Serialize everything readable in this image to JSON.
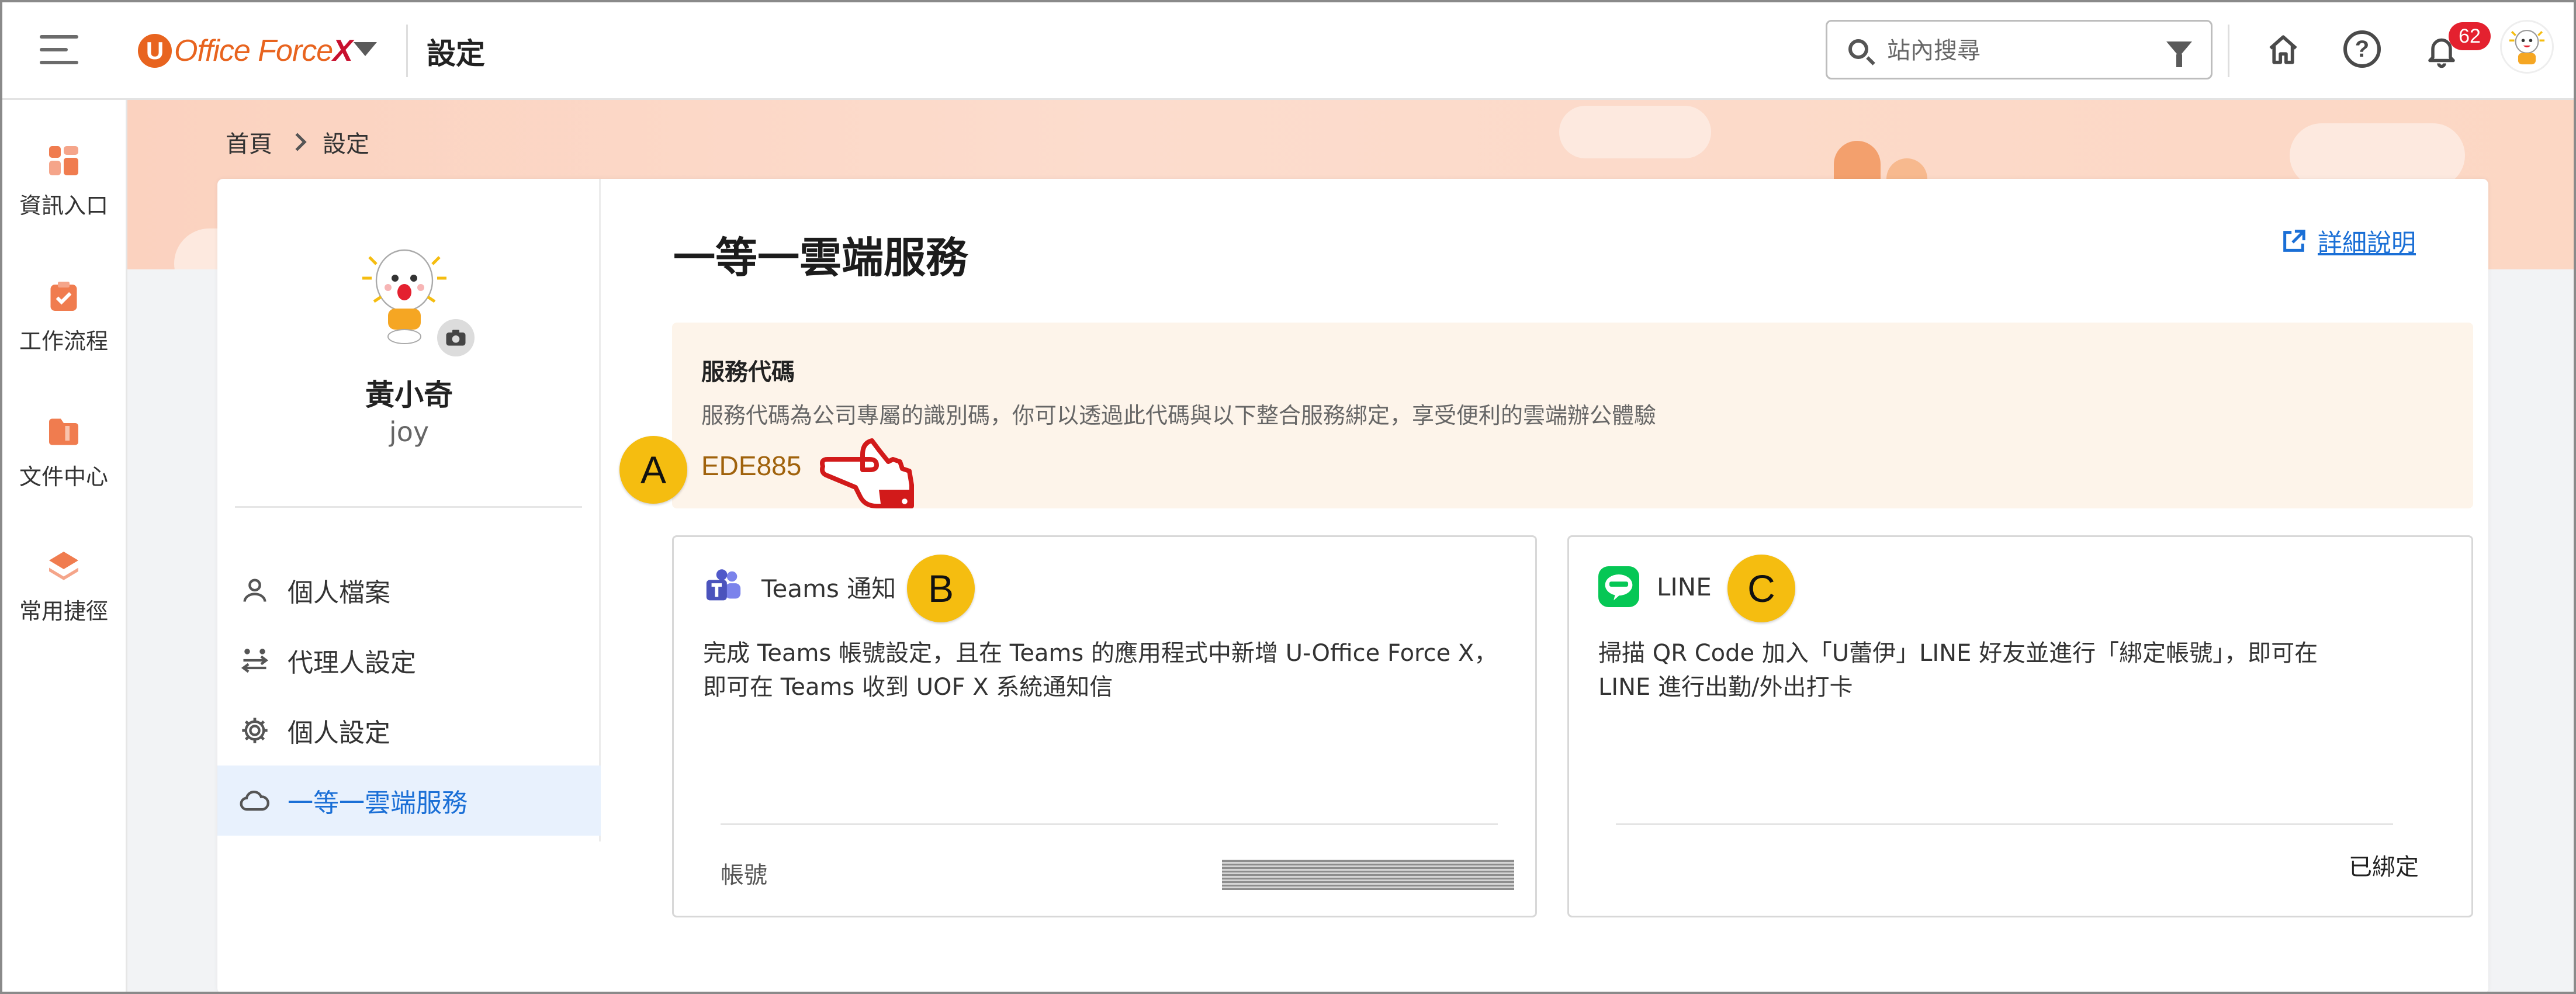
{
  "header": {
    "brand_initial": "U",
    "brand_main": "Office Force",
    "brand_x": "X",
    "title": "設定",
    "search": {
      "placeholder": "站內搜尋",
      "value": ""
    },
    "notification_count": "62"
  },
  "rail": {
    "items": [
      {
        "label": "資訊入口",
        "icon": "dashboard-icon"
      },
      {
        "label": "工作流程",
        "icon": "clipboard-check-icon"
      },
      {
        "label": "文件中心",
        "icon": "folder-icon"
      },
      {
        "label": "常用捷徑",
        "icon": "layers-icon"
      }
    ]
  },
  "breadcrumb": {
    "home": "首頁",
    "current": "設定"
  },
  "profile": {
    "name": "黃小奇",
    "account": "joy",
    "nav": [
      {
        "label": "個人檔案",
        "icon": "person-icon",
        "active": false
      },
      {
        "label": "代理人設定",
        "icon": "swap-users-icon",
        "active": false
      },
      {
        "label": "個人設定",
        "icon": "gear-icon",
        "active": false
      },
      {
        "label": "一等一雲端服務",
        "icon": "cloud-icon",
        "active": true
      }
    ]
  },
  "content": {
    "title": "一等一雲端服務",
    "detail_link": "詳細說明",
    "service_code": {
      "title": "服務代碼",
      "description": "服務代碼為公司專屬的識別碼，你可以透過此代碼與以下整合服務綁定，享受便利的雲端辦公體驗",
      "value": "EDE885"
    },
    "teams": {
      "name": "Teams 通知",
      "description_line1": "完成 Teams 帳號設定，且在 Teams 的應用程式中新增 U-Office Force X，",
      "description_line2": "即可在 Teams 收到 UOF X 系統通知信",
      "footer_label": "帳號"
    },
    "line": {
      "name": "LINE",
      "description_line1": "掃描 QR Code 加入「U蕾伊」LINE 好友並進行「綁定帳號」，即可在",
      "description_line2": "LINE 進行出勤/外出打卡",
      "status": "已綁定"
    }
  },
  "annotations": {
    "a": "A",
    "b": "B",
    "c": "C"
  },
  "colors": {
    "accent": "#1a6fd6",
    "brand": "#e8641f",
    "code_bg": "#fdf4ea",
    "code_text": "#a0620c",
    "marker": "#f5bd10",
    "badge": "#e4212f"
  }
}
